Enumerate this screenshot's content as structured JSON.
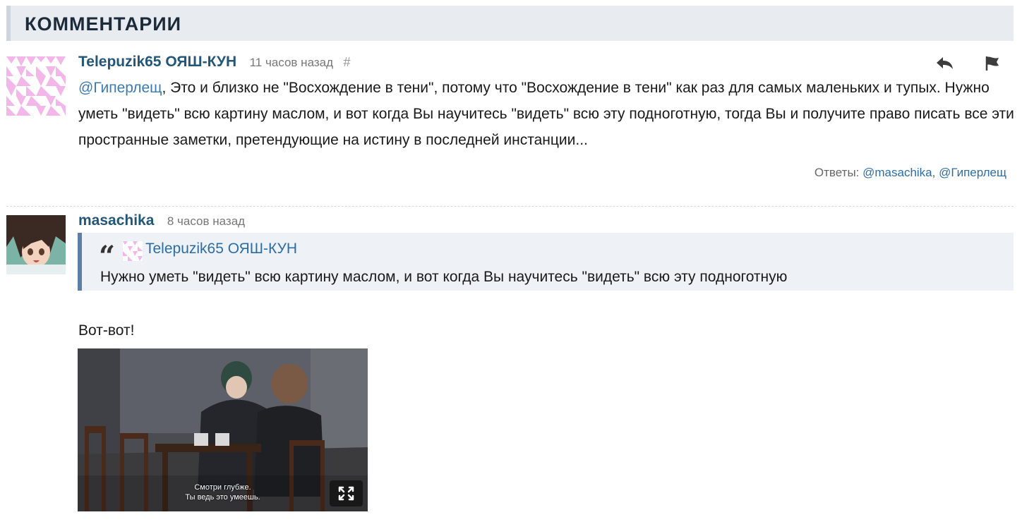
{
  "section": {
    "title": "КОММЕНТАРИИ"
  },
  "comments": [
    {
      "author": "Telepuzik65 ОЯШ-КУН",
      "time": "11 часов назад",
      "permalink": "#",
      "mention": "@Гиперлещ",
      "text": ", Это и близко не \"Восхождение в тени\", потому что \"Восхождение в тени\" как раз для самых маленьких и тупых. Нужно уметь \"видеть\" всю картину маслом, и вот когда Вы научитесь \"видеть\" всю эту подноготную, тогда Вы и получите право писать все эти пространные заметки, претендующие на истину в последней инстанции...",
      "answers_label": "Ответы:",
      "answers": [
        "@masachika",
        "@Гиперлещ"
      ],
      "answers_sep": ", ",
      "actions": {
        "reply_icon": "reply-arrow",
        "flag_icon": "flag"
      }
    },
    {
      "author": "masachika",
      "time": "8 часов назад",
      "quote": {
        "mark": "“",
        "author": "Telepuzik65 ОЯШ-КУН",
        "text": "Нужно уметь \"видеть\" всю картину маслом, и вот когда Вы научитесь \"видеть\" всю эту подноготную"
      },
      "text": "Вот-вот!",
      "image": {
        "subtitle_line1": "Смотри глубже.",
        "subtitle_line2": "Ты ведь это умеешь.",
        "expand_icon": "expand"
      }
    }
  ],
  "colors": {
    "accent": "#22577a",
    "link": "#2c6da3",
    "header_bg": "#e8ebf0",
    "quote_border": "#5b7fa6"
  }
}
